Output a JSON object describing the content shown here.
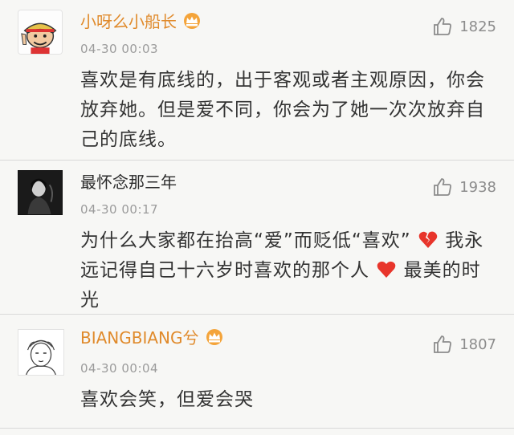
{
  "comments": [
    {
      "username": "小呀么小船长",
      "time": "04-30 00:03",
      "likes": "1825",
      "text": "喜欢是有底线的，出于客观或者主观原因，你会放弃她。但是爱不同，你会为了她一次次放弃自己的底线。",
      "badge_icon": "vip-crown-icon"
    },
    {
      "username": "最怀念那三年",
      "time": "04-30 00:17",
      "likes": "1938",
      "text_part1": "为什么大家都在抬高“爱”而贬低“喜欢”",
      "text_part2": "我永远记得自己十六岁时喜欢的那个人",
      "text_part3": "最美的时光",
      "emoji1": "broken-heart-icon",
      "emoji2": "heart-icon"
    },
    {
      "username": "BIANGBIANG兮",
      "time": "04-30 00:04",
      "likes": "1807",
      "text": "喜欢会笑，但爱会哭",
      "badge_icon": "vip-crown-icon"
    }
  ],
  "colors": {
    "vip_name": "#e08a2b",
    "normal_name": "#2a2a2a",
    "text": "#333333",
    "meta": "#9b9b9b",
    "heart": "#e8352b"
  }
}
